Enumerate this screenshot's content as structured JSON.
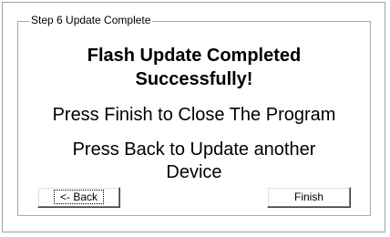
{
  "group": {
    "legend": "Step 6 Update Complete"
  },
  "content": {
    "title_line1": "Flash Update Completed",
    "title_line2": "Successfully!",
    "finish_instruction": "Press Finish to Close The Program",
    "back_instruction_line1": "Press Back to Update another",
    "back_instruction_line2": "Device"
  },
  "buttons": {
    "back_label": "<- Back",
    "finish_label": "Finish"
  }
}
